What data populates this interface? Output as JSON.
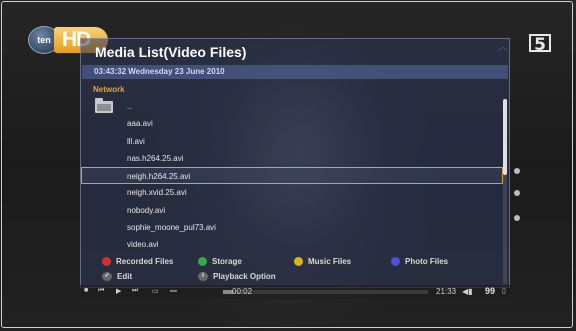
{
  "brand": {
    "circle_text": "ten",
    "hd_text": "HD",
    "channel_badge": "5"
  },
  "panel": {
    "title": "Media List(Video Files)",
    "datetime": "03:43:32 Wednesday 23 June 2010",
    "location": "Network",
    "parent_entry": "..",
    "files": [
      "aaa.avi",
      "lll.avi",
      "nas.h264.25.avi",
      "neigh.h264.25.avi",
      "neigh.xvid.25.avi",
      "nobody.avi",
      "sophie_moone_pul73.avi",
      "video.avi"
    ],
    "selected_index": 3
  },
  "legend": {
    "red": {
      "label": "Recorded Files",
      "color": "#d0312d"
    },
    "green": {
      "label": "Storage",
      "color": "#3aa84a"
    },
    "yellow": {
      "label": "Music Files",
      "color": "#d9b227"
    },
    "blue": {
      "label": "Photo Files",
      "color": "#4f4fd6"
    },
    "edit": {
      "label": "Edit",
      "symbol": "✓"
    },
    "info": {
      "label": "Playback Option",
      "symbol": "i"
    }
  },
  "status": {
    "current_time": "00:02",
    "clock": "21:33",
    "volume": "99",
    "progress": 0.05,
    "controls": [
      "stop",
      "prev",
      "play",
      "next",
      "subtitle",
      "display"
    ]
  }
}
